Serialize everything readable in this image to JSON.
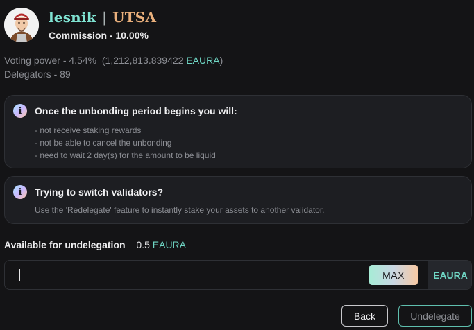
{
  "validator": {
    "name": "lesnik",
    "separator": "|",
    "org": "UTSA",
    "commission": "Commission - 10.00%"
  },
  "stats": {
    "voting_power_prefix": "Voting power - 4.54%",
    "voting_power_open": "(1,212,813.839422",
    "voting_power_denom": "EAURA",
    "voting_power_close": ")",
    "delegators": "Delegators - 89"
  },
  "unbonding_notice": {
    "icon": "info-icon",
    "title": "Once the unbonding period begins you will:",
    "items": [
      "- not receive staking rewards",
      "- not be able to cancel the unbonding",
      "- need to wait 2 day(s) for the amount to be liquid"
    ]
  },
  "switch_notice": {
    "icon": "info-icon",
    "title": "Trying to switch validators?",
    "text": "Use the 'Redelegate' feature to instantly stake your assets to another validator."
  },
  "available": {
    "label": "Available for undelegation",
    "amount": "0.5",
    "denom": "EAURA"
  },
  "amount_input": {
    "value": "",
    "max_label": "MAX",
    "denom": "EAURA"
  },
  "actions": {
    "back_label": "Back",
    "undelegate_label": "Undelegate"
  },
  "colors": {
    "background": "#141416",
    "accent_teal": "#6fd6c4",
    "accent_orange": "#eab07c"
  }
}
